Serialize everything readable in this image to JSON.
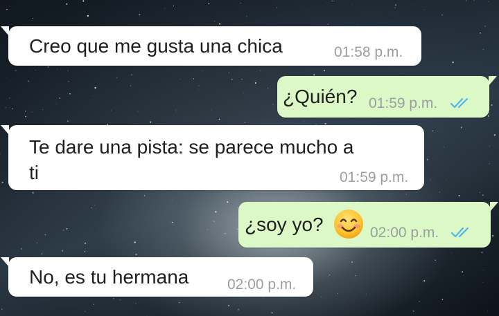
{
  "chat": {
    "messages": [
      {
        "direction": "incoming",
        "text": "Creo que me gusta una chica",
        "time": "01:58 p.m."
      },
      {
        "direction": "outgoing",
        "text": "¿Quién?",
        "time": "01:59 p.m.",
        "status_icon": "double-check-icon"
      },
      {
        "direction": "incoming",
        "text_line1": "Te dare una pista: se parece mucho a",
        "text_line2": "ti",
        "time": "01:59 p.m."
      },
      {
        "direction": "outgoing",
        "text": "¿soy yo?",
        "emoji": "smiling-face-emoji",
        "time": "02:00 p.m.",
        "status_icon": "double-check-icon"
      },
      {
        "direction": "incoming",
        "text": "No, es tu hermana",
        "time": "02:00 p.m."
      }
    ],
    "colors": {
      "incoming_bubble": "#ffffff",
      "outgoing_bubble": "#dcf8c6",
      "timestamp": "#9a9ea2",
      "read_ticks": "#4fb6ec"
    },
    "background": "galaxy-wallpaper"
  }
}
